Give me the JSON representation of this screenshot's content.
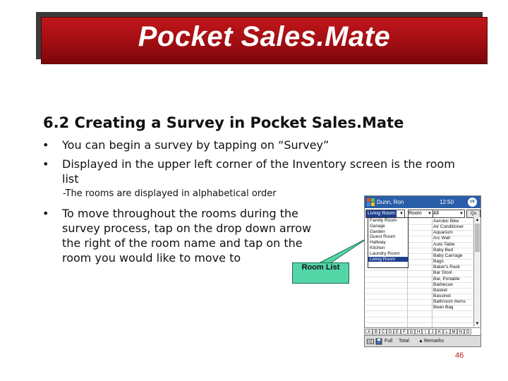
{
  "slide": {
    "title": "Pocket Sales.Mate",
    "heading": "6.2 Creating a Survey in Pocket Sales.Mate",
    "bullets": [
      "You can begin a survey by tapping on “Survey”",
      "Displayed in the upper left corner of the Inventory screen is the room list",
      "To move throughout the rooms during the survey process, tap on the drop down arrow the right of the room name and tap on the room you would like to move to"
    ],
    "bullet_lines": {
      "b2_line1": "Displayed in the upper left corner of the Inventory screen is the room",
      "b2_line2": "list",
      "b3_line1": "To move throughout the rooms during the",
      "b3_line2": "survey process, tap on the drop down arrow",
      "b3_line3": "the right of the room name and tap on the",
      "b3_line4": "room you would like to move to"
    },
    "bullet_marker": "•",
    "note": "-The rooms are displayed in alphabetical order",
    "callout": "Room List",
    "page_number": "46"
  },
  "pda": {
    "app_title": "Dunn, Ron",
    "time": "12:50",
    "ok": "ok",
    "room_combo_value": "Living Room",
    "room_combo2": "Room",
    "category_combo": "All",
    "button_add": "Qu",
    "button_view": "Qu",
    "room_dropdown": [
      "Family Room",
      "Garage",
      "Garden",
      "Guest Room",
      "Hallway",
      "Kitchen",
      "Laundry Room",
      "Living Room"
    ],
    "room_dropdown_selected": "Living Room",
    "items": [
      "Aerobic Bike",
      "Air Conditioner",
      "Aquarium",
      "Arc Wall",
      "Auto Table",
      "Baby Bed",
      "Baby Carriage",
      "Bags",
      "Baker's Rack",
      "Bar Stool",
      "Bar, Portable",
      "Barbecue",
      "Basket",
      "Bassinet",
      "Bathroom Items",
      "Bean Bag"
    ],
    "letter_keys": [
      "A",
      "B",
      "C",
      "D",
      "E",
      "F",
      "G",
      "H",
      "I",
      "J",
      "K",
      "L",
      "M",
      "N",
      "O"
    ],
    "toolbar": {
      "item1": "Full",
      "item2": "Total",
      "item3": "Remarks"
    },
    "colors": {
      "title_bar": "#2a5ea8",
      "selection": "#1c3f8f",
      "banner": "#b3121a",
      "callout": "#55d6a8"
    }
  }
}
